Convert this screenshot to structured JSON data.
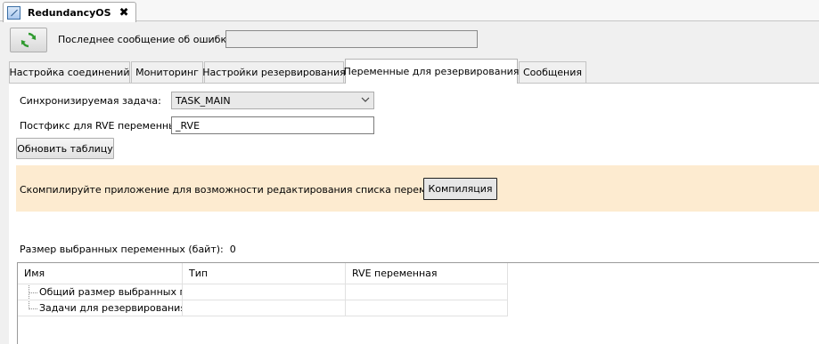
{
  "editor": {
    "tab_title": "RedundancyOS",
    "close_glyph": "✖"
  },
  "toolbar": {
    "refresh_icon": "refresh-arrows-icon",
    "refresh_color": "#2e9a2e",
    "error_label": "Последнее сообщение об ошибке:",
    "error_value": ""
  },
  "tabs": [
    {
      "label": "Настройка соединений"
    },
    {
      "label": "Мониторинг"
    },
    {
      "label": "Настройки резервирования"
    },
    {
      "label": "Переменные для резервирования"
    },
    {
      "label": "Сообщения"
    }
  ],
  "content": {
    "task_label": "Синхронизируемая задача:",
    "task_value": "TASK_MAIN",
    "postfix_label": "Постфикс для RVE переменных:",
    "postfix_value": "_RVE",
    "update_button": "Обновить таблицу",
    "warning_text": "Скомпилируйте приложение для возможности редактирования списка переменных.",
    "warning_bg": "#fdebd0",
    "compile_button": "Компиляция",
    "size_label": "Размер выбранных переменных (байт):",
    "size_value": "0"
  },
  "tree": {
    "columns": [
      "Имя",
      "Тип",
      "RVE переменная"
    ],
    "rows": [
      {
        "name": "Общий размер выбранных п...",
        "type": "",
        "rve": ""
      },
      {
        "name": "Задачи для резервирования:",
        "type": "",
        "rve": ""
      }
    ]
  }
}
